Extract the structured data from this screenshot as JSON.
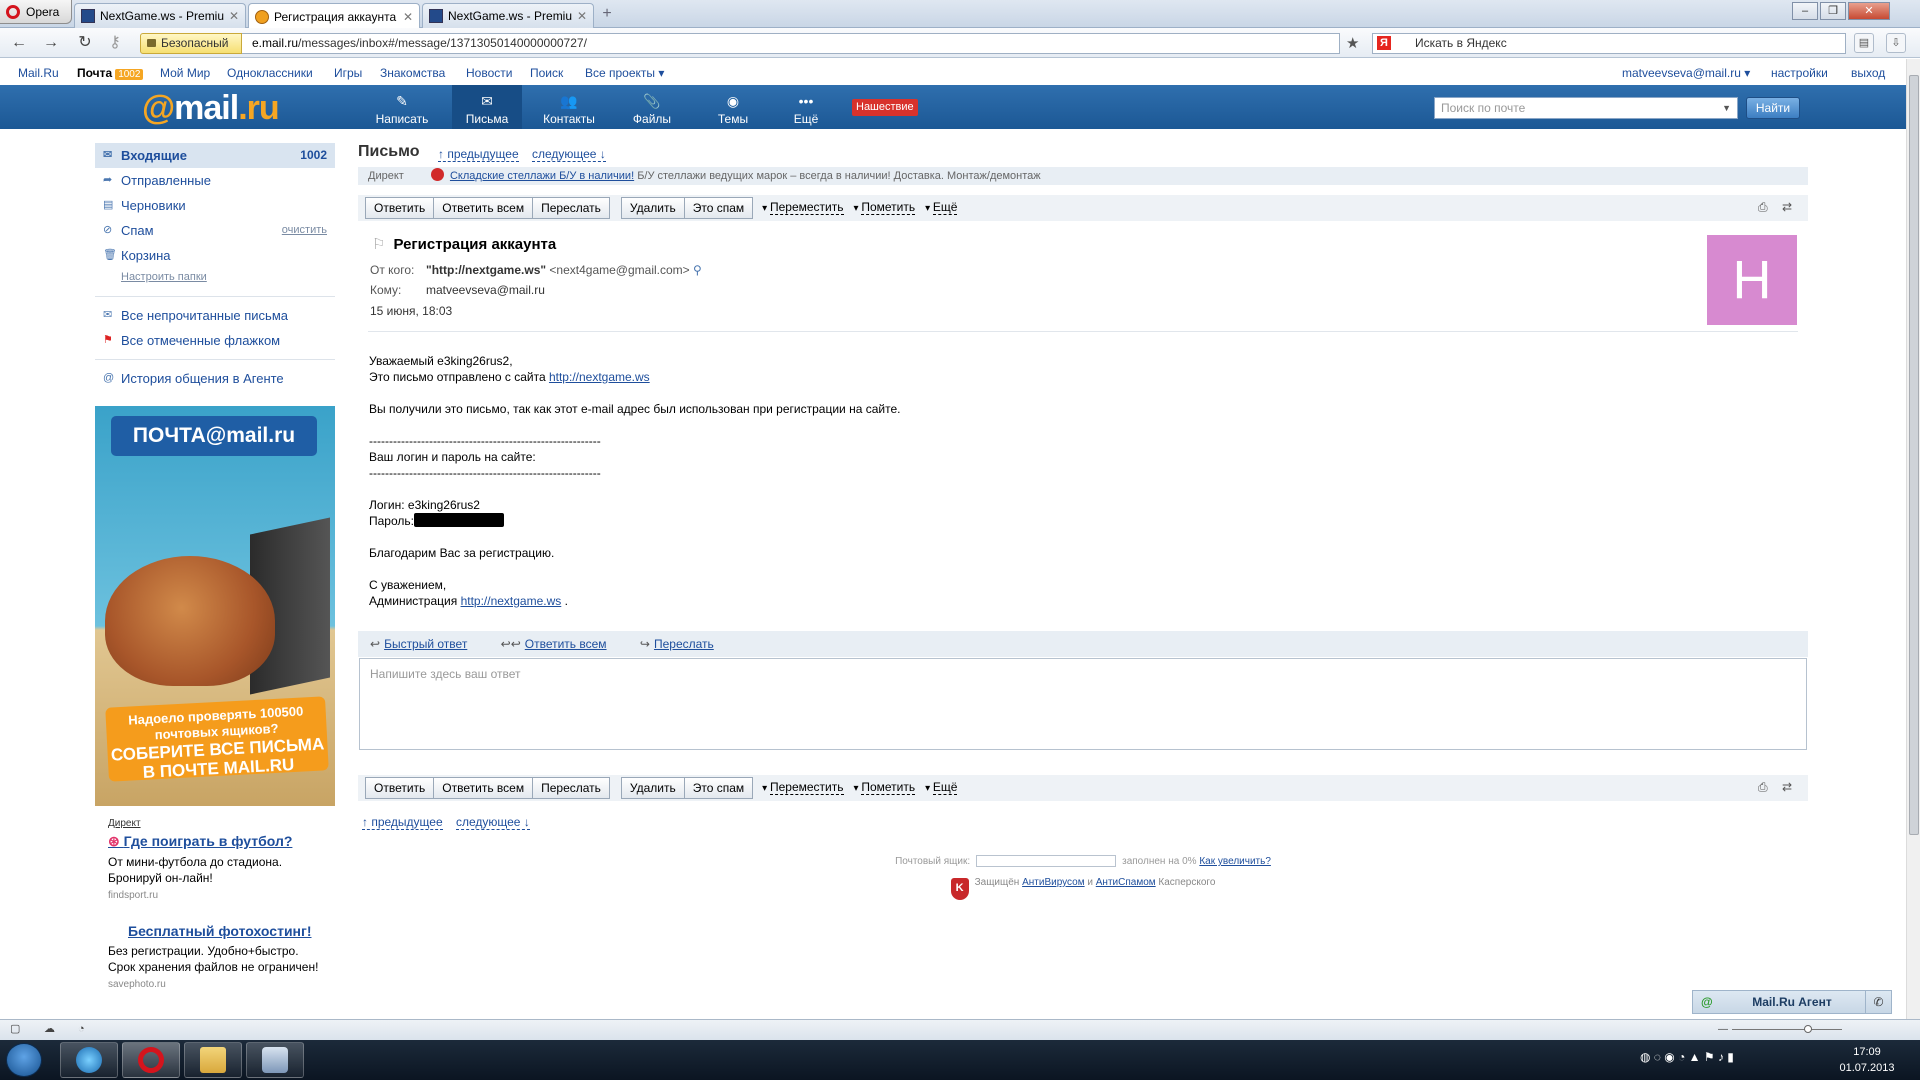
{
  "browser": {
    "menu_label": "Opera",
    "tabs": [
      {
        "title": "NextGame.ws - Premiu..."
      },
      {
        "title": "Регистрация аккаунта ..."
      },
      {
        "title": "NextGame.ws - Premiu..."
      }
    ],
    "security_label": "Безопасный",
    "url_host": "e.mail.ru",
    "url_path": "/messages/inbox#/message/13713050140000000727/",
    "search_placeholder": "Искать в Яндекс"
  },
  "portal": {
    "links": [
      "Mail.Ru",
      "Почта",
      "Мой Мир",
      "Одноклассники",
      "Игры",
      "Знакомства",
      "Новости",
      "Поиск",
      "Все проекты"
    ],
    "mail_count": "1002",
    "user_email": "matveevseva@mail.ru",
    "settings": "настройки",
    "logout": "выход"
  },
  "header": {
    "logo_at": "@",
    "logo_mail": "mail",
    "logo_ru": ".ru",
    "nav": [
      "Написать",
      "Письма",
      "Контакты",
      "Файлы",
      "Темы",
      "Ещё"
    ],
    "invasion": "Нашествие",
    "search_placeholder": "Поиск по почте",
    "find_button": "Найти"
  },
  "sidebar": {
    "folders": [
      {
        "label": "Входящие",
        "count": "1002"
      },
      {
        "label": "Отправленные"
      },
      {
        "label": "Черновики"
      },
      {
        "label": "Спам",
        "action": "очистить"
      },
      {
        "label": "Корзина"
      }
    ],
    "setup_folders": "Настроить папки",
    "unread": "Все непрочитанные письма",
    "flagged": "Все отмеченные флажком",
    "agent_history": "История общения в Агенте",
    "banner": {
      "logo": "ПОЧТА@mail.ru",
      "line1": "Надоело проверять 100500 почтовых ящиков?",
      "line2": "СОБЕРИТЕ ВСЕ ПИСЬМА В ПОЧТЕ MAIL.RU"
    },
    "direct_label": "Директ",
    "ads": [
      {
        "title": "Где поиграть в футбол?",
        "text": "От мини-футбола до стадиона. Бронируй он-лайн!",
        "site": "findsport.ru"
      },
      {
        "title": "Бесплатный фотохостинг!",
        "text": "Без регистрации. Удобно+быстро. Срок хранения файлов не ограничен!",
        "site": "savephoto.ru"
      }
    ]
  },
  "message": {
    "page_title": "Письмо",
    "prev": "↑ предыдущее",
    "next": "следующее ↓",
    "ad_label": "Директ",
    "ad_link": "Складские стеллажи Б/У в наличии!",
    "ad_text": "Б/У стеллажи ведущих марок – всегда в наличии! Доставка. Монтаж/демонтаж",
    "toolbar": {
      "reply": "Ответить",
      "reply_all": "Ответить всем",
      "forward": "Переслать",
      "delete": "Удалить",
      "spam": "Это спам",
      "move": "Переместить",
      "mark": "Пометить",
      "more": "Ещё"
    },
    "subject": "Регистрация аккаунта",
    "from_label": "От кого:",
    "from_name": "\"http://nextgame.ws\"",
    "from_email": "<next4game@gmail.com>",
    "to_label": "Кому:",
    "to": "matveevseva@mail.ru",
    "date": "15 июня, 18:03",
    "avatar_letter": "H",
    "body": {
      "greeting": "Уважаемый e3king26rus2,",
      "line1": "Это письмо отправлено с сайта",
      "site": "http://nextgame.ws",
      "line2": "Вы получили это письмо, так как этот e-mail адрес был использован при регистрации на сайте.",
      "dashes": "----------------------------------------------------------",
      "creds_title": "Ваш логин и пароль на сайте:",
      "login": "Логин: e3king26rus2",
      "password_label": "Пароль:",
      "thanks": "Благодарим Вас за регистрацию.",
      "regards": "С уважением,",
      "admin": "Администрация",
      "admin_site": "http://nextgame.ws",
      "admin_tail": "."
    },
    "quick_reply": "Быстрый ответ",
    "reply_all_link": "Ответить всем",
    "forward_link": "Переслать",
    "reply_placeholder": "Напишите здесь ваш ответ",
    "quota_label": "Почтовый ящик:",
    "quota_text": "заполнен на 0%",
    "quota_link": "Как увеличить?",
    "protected": "Защищён",
    "antivirus": "АнтиВирусом",
    "and": "и",
    "antispam": "АнтиСпамом",
    "kaspersky": "Касперского"
  },
  "agent": {
    "label": "Mail.Ru Агент"
  },
  "clock": {
    "time": "17:09",
    "date": "01.07.2013"
  }
}
